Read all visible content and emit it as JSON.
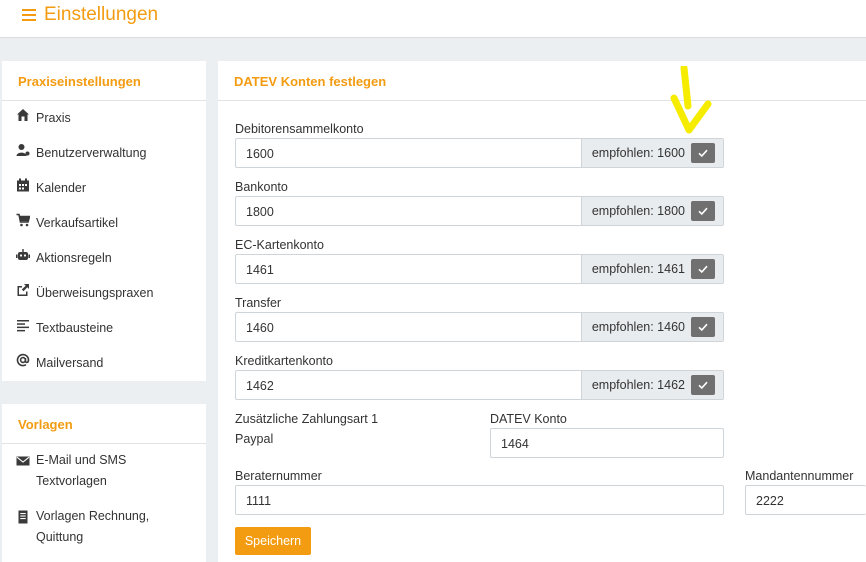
{
  "header": {
    "title": "Einstellungen"
  },
  "sidebar": {
    "heading": "Praxiseinstellungen",
    "items": [
      {
        "label": "Praxis",
        "icon": "home-icon"
      },
      {
        "label": "Benutzerverwaltung",
        "icon": "user-cog-icon"
      },
      {
        "label": "Kalender",
        "icon": "calendar-icon"
      },
      {
        "label": "Verkaufsartikel",
        "icon": "cart-icon"
      },
      {
        "label": "Aktionsregeln",
        "icon": "robot-icon"
      },
      {
        "label": "Überweisungspraxen",
        "icon": "share-icon"
      },
      {
        "label": "Textbausteine",
        "icon": "align-left-icon"
      },
      {
        "label": "Mailversand",
        "icon": "at-icon"
      }
    ]
  },
  "templates": {
    "heading": "Vorlagen",
    "items": [
      {
        "line1": "E-Mail und SMS",
        "line2": "Textvorlagen",
        "icon": "envelope-icon"
      },
      {
        "line1": "Vorlagen Rechnung,",
        "line2": "Quittung",
        "icon": "document-icon"
      }
    ]
  },
  "main": {
    "heading": "DATEV Konten festlegen",
    "accounts": [
      {
        "label": "Debitorensammelkonto",
        "value": "1600",
        "recommended": "empfohlen: 1600"
      },
      {
        "label": "Bankonto",
        "value": "1800",
        "recommended": "empfohlen: 1800"
      },
      {
        "label": "EC-Kartenkonto",
        "value": "1461",
        "recommended": "empfohlen: 1461"
      },
      {
        "label": "Transfer",
        "value": "1460",
        "recommended": "empfohlen: 1460"
      },
      {
        "label": "Kreditkartenkonto",
        "value": "1462",
        "recommended": "empfohlen: 1462"
      }
    ],
    "extra_payment": {
      "label": "Zusätzliche Zahlungsart 1",
      "value": "Paypal"
    },
    "datev_account": {
      "label": "DATEV Konto",
      "value": "1464"
    },
    "consultant": {
      "label": "Beraternummer",
      "value": "1111"
    },
    "client": {
      "label": "Mandantennummer",
      "value": "2222"
    },
    "save_label": "Speichern"
  },
  "colors": {
    "accent": "#f39c12",
    "annotation_arrow": "#f5ec00",
    "check_button": "#707070"
  }
}
